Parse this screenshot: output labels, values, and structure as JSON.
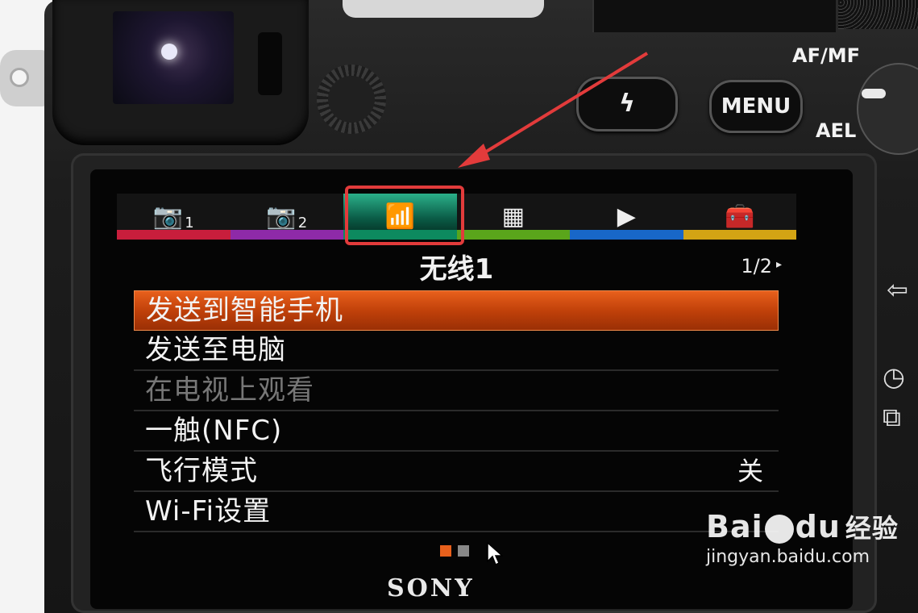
{
  "camera": {
    "flash_symbol": "ϟ",
    "menu_button": "MENU",
    "af_mf_label": "AF/MF",
    "ael_label": "AEL",
    "brand": "SONY"
  },
  "tabs": [
    {
      "icon": "camera-icon",
      "glyph": "📷",
      "num": "1",
      "stripe": "#c81e3c"
    },
    {
      "icon": "camera-icon",
      "glyph": "📷",
      "num": "2",
      "stripe": "#8e2aa8"
    },
    {
      "icon": "wireless-icon",
      "glyph": "📶",
      "num": "",
      "stripe": "#0d8a5f",
      "active": true
    },
    {
      "icon": "grid-icon",
      "glyph": "▦",
      "num": "",
      "stripe": "#5aa51b"
    },
    {
      "icon": "playback-icon",
      "glyph": "▶",
      "num": "",
      "stripe": "#1867c8"
    },
    {
      "icon": "toolbox-icon",
      "glyph": "🧰",
      "num": "",
      "stripe": "#d3a414"
    }
  ],
  "menu": {
    "title": "无线1",
    "page": "1/2",
    "page_arrow": "▸",
    "items": [
      {
        "label": "发送到智能手机",
        "value": "",
        "state": "selected"
      },
      {
        "label": "发送至电脑",
        "value": "",
        "state": "normal"
      },
      {
        "label": "在电视上观看",
        "value": "",
        "state": "disabled"
      },
      {
        "label": "一触(NFC)",
        "value": "",
        "state": "normal"
      },
      {
        "label": "飞行模式",
        "value": "关",
        "state": "normal"
      },
      {
        "label": "Wi-Fi设置",
        "value": "",
        "state": "normal"
      }
    ],
    "page_dots": [
      {
        "color": "#e8601c",
        "active": true
      },
      {
        "color": "#888888",
        "active": false
      }
    ]
  },
  "watermark": {
    "logo_text": "Bai",
    "logo_text2": "du",
    "logo_cn": "经验",
    "url": "jingyan.baidu.com"
  },
  "colors": {
    "highlight_frame": "#e23b3b",
    "selected_row": "#c1410a"
  }
}
